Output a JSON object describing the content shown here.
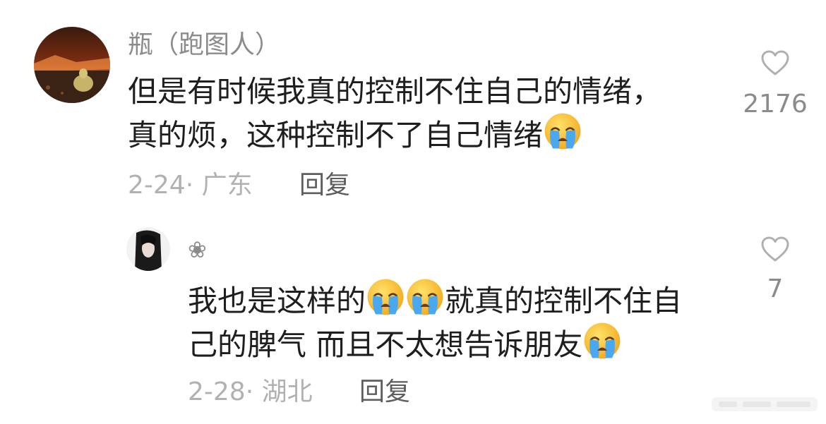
{
  "comments": [
    {
      "username": "瓶（跑图人）",
      "lines": [
        [
          "但是有时候我真的控制不住自己的情绪，"
        ],
        [
          "真的烦，这种控制不了自己情绪",
          "[cry-emoji]"
        ]
      ],
      "date_location": "2-24· 广东",
      "reply_label": "回复",
      "like_count": "2176"
    },
    {
      "username": "❀",
      "lines": [
        [
          "我也是这样的",
          "[cry-emoji]",
          "[cry-emoji]",
          "就真的控制不住自"
        ],
        [
          "己的脾气 而且不太想告诉朋友",
          "[cry-emoji]"
        ]
      ],
      "date_location": "2-28· 湖北",
      "reply_label": "回复",
      "like_count": "7"
    }
  ],
  "colors": {
    "username": "#8b8b8b",
    "content": "#1e1e1e",
    "meta": "#b1b1b1",
    "reply": "#5d5d5d",
    "like_icon": "#b0b0b0"
  },
  "icons": {
    "like": "heart-outline-icon",
    "emoji": "loudly-crying-face-emoji"
  }
}
